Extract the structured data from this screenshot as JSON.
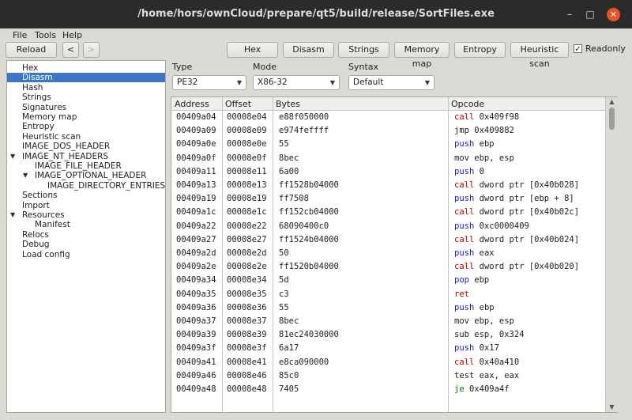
{
  "window": {
    "title": "/home/hors/ownCloud/prepare/qt5/build/release/SortFiles.exe"
  },
  "menu": [
    "File",
    "Tools",
    "Help"
  ],
  "toolbar": {
    "reload": "Reload",
    "back": "<",
    "forward": ">",
    "hex": "Hex",
    "disasm": "Disasm",
    "strings": "Strings",
    "memory_map": "Memory map",
    "entropy": "Entropy",
    "heuristic_scan": "Heuristic scan",
    "readonly": "Readonly",
    "readonly_checked": true
  },
  "tree": [
    {
      "label": "Hex",
      "level": 0
    },
    {
      "label": "Disasm",
      "level": 0,
      "selected": true
    },
    {
      "label": "Hash",
      "level": 0
    },
    {
      "label": "Strings",
      "level": 0
    },
    {
      "label": "Signatures",
      "level": 0
    },
    {
      "label": "Memory map",
      "level": 0
    },
    {
      "label": "Entropy",
      "level": 0
    },
    {
      "label": "Heuristic scan",
      "level": 0
    },
    {
      "label": "IMAGE_DOS_HEADER",
      "level": 0
    },
    {
      "label": "IMAGE_NT_HEADERS",
      "level": 0,
      "expanded": true
    },
    {
      "label": "IMAGE_FILE_HEADER",
      "level": 1
    },
    {
      "label": "IMAGE_OPTIONAL_HEADER",
      "level": 1,
      "expanded": true
    },
    {
      "label": "IMAGE_DIRECTORY_ENTRIES",
      "level": 2
    },
    {
      "label": "Sections",
      "level": 0
    },
    {
      "label": "Import",
      "level": 0
    },
    {
      "label": "Resources",
      "level": 0,
      "expanded": true
    },
    {
      "label": "Manifest",
      "level": 1
    },
    {
      "label": "Relocs",
      "level": 0
    },
    {
      "label": "Debug",
      "level": 0
    },
    {
      "label": "Load config",
      "level": 0
    }
  ],
  "options": {
    "type_label": "Type",
    "type_value": "PE32",
    "mode_label": "Mode",
    "mode_value": "X86-32",
    "syntax_label": "Syntax",
    "syntax_value": "Default"
  },
  "table": {
    "headers": [
      "Address",
      "Offset",
      "Bytes",
      "Opcode"
    ],
    "rows": [
      [
        "00409a04",
        "00008e04",
        "e88f050000",
        "call 0x409f98",
        "call"
      ],
      [
        "00409a09",
        "00008e09",
        "e974feffff",
        "jmp 0x409882",
        "plain"
      ],
      [
        "00409a0e",
        "00008e0e",
        "55",
        "push ebp",
        "push"
      ],
      [
        "00409a0f",
        "00008e0f",
        "8bec",
        "mov ebp, esp",
        "plain"
      ],
      [
        "00409a11",
        "00008e11",
        "6a00",
        "push 0",
        "push"
      ],
      [
        "00409a13",
        "00008e13",
        "ff1528b04000",
        "call dword ptr [0x40b028]",
        "call"
      ],
      [
        "00409a19",
        "00008e19",
        "ff7508",
        "push dword ptr [ebp + 8]",
        "push"
      ],
      [
        "00409a1c",
        "00008e1c",
        "ff152cb04000",
        "call dword ptr [0x40b02c]",
        "call"
      ],
      [
        "00409a22",
        "00008e22",
        "68090400c0",
        "push 0xc0000409",
        "push"
      ],
      [
        "00409a27",
        "00008e27",
        "ff1524b04000",
        "call dword ptr [0x40b024]",
        "call"
      ],
      [
        "00409a2d",
        "00008e2d",
        "50",
        "push eax",
        "push"
      ],
      [
        "00409a2e",
        "00008e2e",
        "ff1520b04000",
        "call dword ptr [0x40b020]",
        "call"
      ],
      [
        "00409a34",
        "00008e34",
        "5d",
        "pop ebp",
        "pop"
      ],
      [
        "00409a35",
        "00008e35",
        "c3",
        "ret",
        "ret"
      ],
      [
        "00409a36",
        "00008e36",
        "55",
        "push ebp",
        "push"
      ],
      [
        "00409a37",
        "00008e37",
        "8bec",
        "mov ebp, esp",
        "plain"
      ],
      [
        "00409a39",
        "00008e39",
        "81ec24030000",
        "sub esp, 0x324",
        "plain"
      ],
      [
        "00409a3f",
        "00008e3f",
        "6a17",
        "push 0x17",
        "push"
      ],
      [
        "00409a41",
        "00008e41",
        "e8ca090000",
        "call 0x40a410",
        "call"
      ],
      [
        "00409a46",
        "00008e46",
        "85c0",
        "test eax, eax",
        "plain"
      ],
      [
        "00409a48",
        "00008e48",
        "7405",
        "je 0x409a4f",
        "jcc"
      ]
    ]
  }
}
